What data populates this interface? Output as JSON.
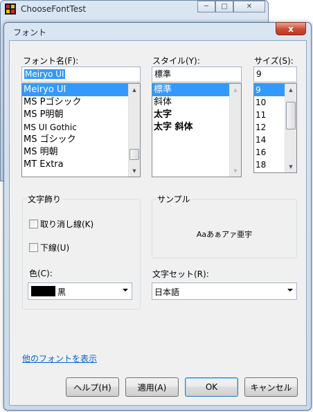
{
  "background_window": {
    "title": "ChooseFontTest"
  },
  "dialog": {
    "title": "フォント",
    "close_glyph": "x"
  },
  "font": {
    "label": "フォント名(F):",
    "value": "Meiryo UI",
    "items": [
      "Meiryo UI",
      "MS Pゴシック",
      "MS P明朝",
      "MS UI Gothic",
      "MS ゴシック",
      "MS 明朝",
      "MT Extra"
    ],
    "selected_index": 0
  },
  "style": {
    "label": "スタイル(Y):",
    "value": "標準",
    "items": [
      "標準",
      "斜体",
      "太字",
      "太字 斜体"
    ],
    "selected_index": 0
  },
  "size": {
    "label": "サイズ(S):",
    "value": "9",
    "items": [
      "9",
      "10",
      "11",
      "12",
      "14",
      "16",
      "18"
    ],
    "selected_index": 0
  },
  "effects": {
    "label": "文字飾り",
    "strikeout_label": "取り消し線(K)",
    "underline_label": "下線(U)",
    "color_label": "色(C):",
    "color_value": "黒",
    "color_swatch": "#000000"
  },
  "sample": {
    "label": "サンプル",
    "text": "Aaあぁアァ亜宇"
  },
  "script": {
    "label": "文字セット(R):",
    "value": "日本語"
  },
  "more_fonts_link": "他のフォントを表示",
  "buttons": {
    "help": "ヘルプ(H)",
    "apply": "適用(A)",
    "ok": "OK",
    "cancel": "キャンセル"
  },
  "colors": {
    "selection": "#3399ff",
    "link": "#0066cc"
  }
}
